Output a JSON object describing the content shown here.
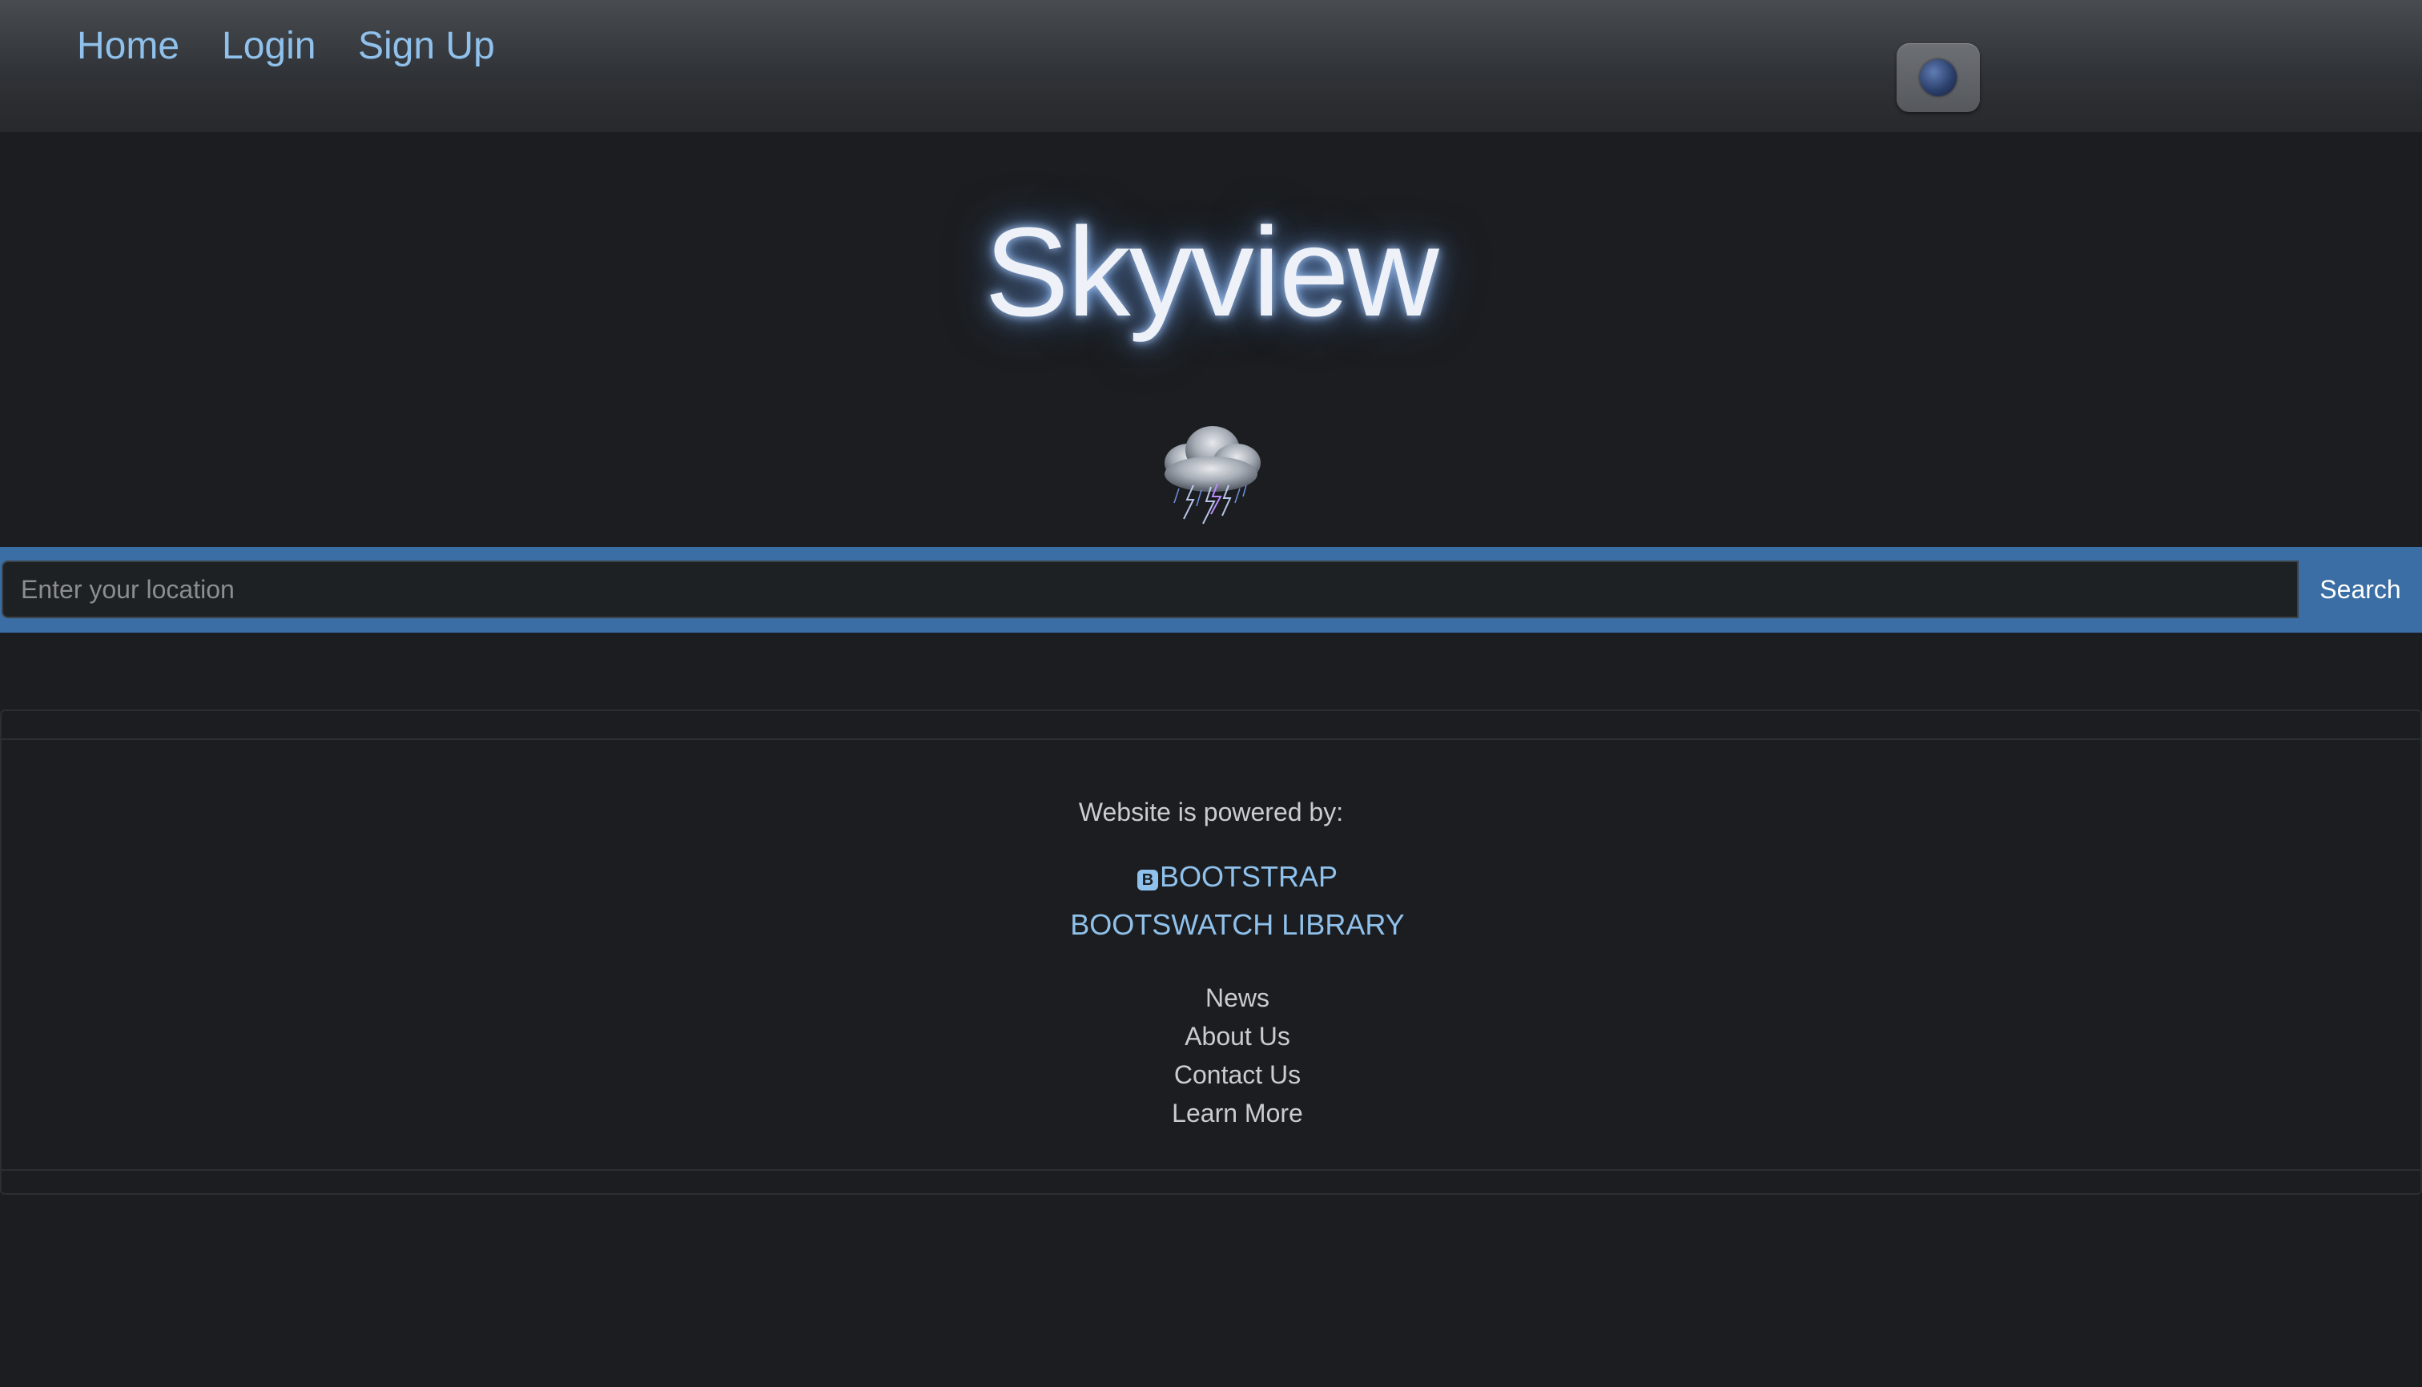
{
  "nav": {
    "items": [
      {
        "label": "Home"
      },
      {
        "label": "Login"
      },
      {
        "label": "Sign Up"
      }
    ]
  },
  "theme_toggle": {
    "icon": "moon-icon"
  },
  "hero": {
    "title": "Skyview",
    "weather_icon": "thunderstorm-cloud-icon"
  },
  "search": {
    "placeholder": "Enter your location",
    "value": "",
    "button_label": "Search"
  },
  "footer": {
    "powered_by": "Website is powered by:",
    "brands": [
      {
        "label": "BOOTSTRAP",
        "icon": "bootstrap-icon"
      },
      {
        "label": "BOOTSWATCH LIBRARY"
      }
    ],
    "links": [
      {
        "label": "News"
      },
      {
        "label": "About Us"
      },
      {
        "label": "Contact Us"
      },
      {
        "label": "Learn More"
      }
    ]
  },
  "colors": {
    "background": "#1b1d20",
    "accent": "#3a6ea5",
    "link": "#8fc1ec"
  }
}
